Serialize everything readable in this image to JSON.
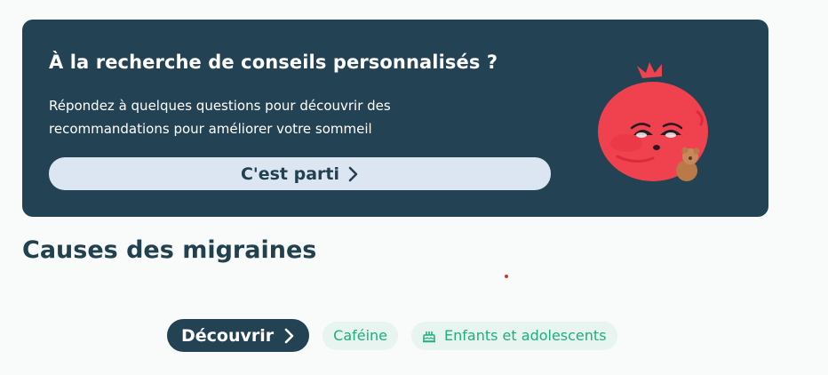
{
  "banner": {
    "title": "À la recherche de conseils personnalisés ?",
    "text": "Répondez à quelques questions pour découvrir des recommandations pour améliorer votre sommeil",
    "cta_label": "C'est parti",
    "mascot_icon": "pomegranate-mascot-icon"
  },
  "section": {
    "title": "Causes des migraines"
  },
  "chips": {
    "discover_label": "Découvrir",
    "items": [
      {
        "label": "Caféine",
        "icon": ""
      },
      {
        "label": "Enfants et adolescents",
        "icon": "cake-icon"
      }
    ]
  },
  "colors": {
    "banner_bg": "#234354",
    "cta_bg": "#dce6f3",
    "chip_bg": "#e7f4ef",
    "chip_text": "#1fae7e",
    "mascot": "#f0424e"
  }
}
